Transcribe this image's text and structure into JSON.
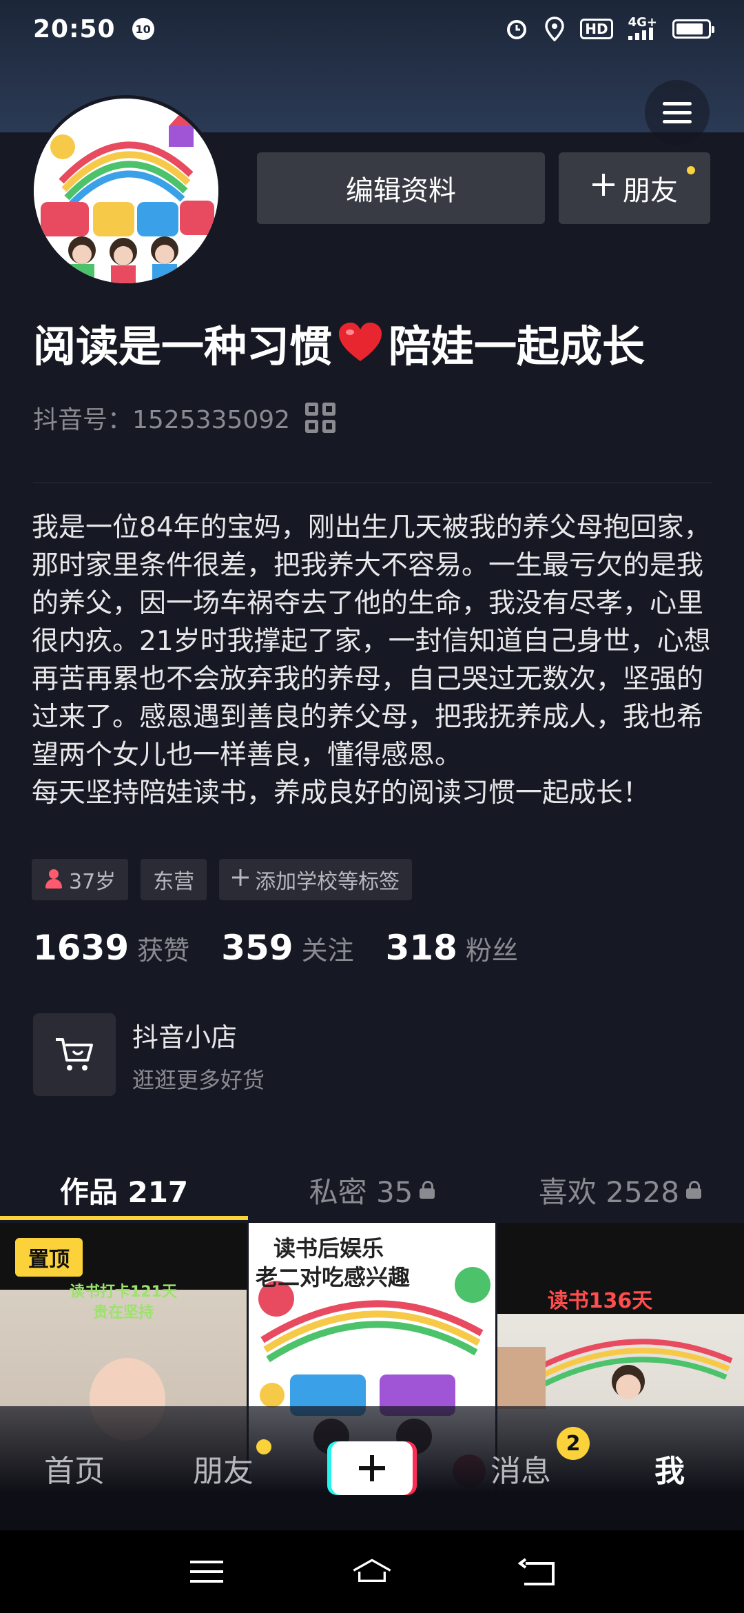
{
  "status_bar": {
    "time": "20:50",
    "badge": "10",
    "network": "4G+",
    "hd": "HD"
  },
  "profile": {
    "name_part1": "阅读是一种习惯",
    "name_part2": "陪娃一起成长",
    "douyin_id": "抖音号：1525335092"
  },
  "actions": {
    "edit_label": "编辑资料",
    "friend_label": "朋友"
  },
  "bio": {
    "line1": "我是一位84年的宝妈，刚出生几天被我的养父母抱回家，那时家里条件很差，把我养大不容易。一生最亏欠的是我的养父，因一场车祸夺去了他的生命，我没有尽孝，心里很内疚。21岁时我撑起了家，一封信知道自己身世，心想再苦再累也不会放弃我的养母，自己哭过无数次，坚强的过来了。感恩遇到善良的养父母，把我抚养成人，我也希望两个女儿也一样善良，懂得感恩。",
    "line2": "每天坚持陪娃读书，养成良好的阅读习惯一起成长！"
  },
  "tags": {
    "age": "37岁",
    "city": "东营",
    "add_school": "添加学校等标签"
  },
  "stats": {
    "likes_count": "1639",
    "likes_label": "获赞",
    "following_count": "359",
    "following_label": "关注",
    "fans_count": "318",
    "fans_label": "粉丝"
  },
  "shop": {
    "title": "抖音小店",
    "subtitle": "逛逛更多好货"
  },
  "tabs": {
    "works": "作品 217",
    "private": "私密 35",
    "likes": "喜欢 2528"
  },
  "grid": {
    "pin_label": "置顶",
    "cell1_caption1": "读书打卡121天",
    "cell1_caption2": "贵在坚持",
    "cell2_caption1": "读书后娱乐",
    "cell2_caption2": "老二对吃感兴趣",
    "cell3_caption": "读书136天"
  },
  "bottom_nav": {
    "home": "首页",
    "friends": "朋友",
    "messages": "消息",
    "messages_badge": "2",
    "me": "我"
  },
  "colors": {
    "background": "#161823",
    "accent": "#fbd23a",
    "button": "#393b44",
    "muted_text": "#8a8b91"
  }
}
